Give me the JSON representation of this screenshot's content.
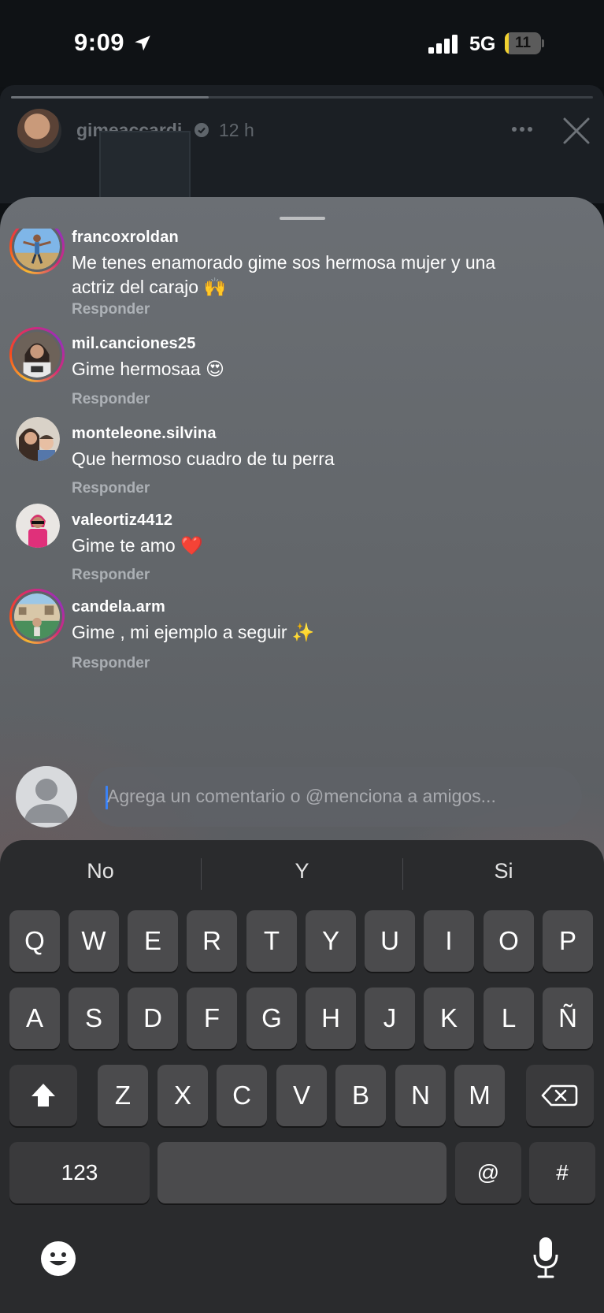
{
  "status_bar": {
    "time": "9:09",
    "network": "5G",
    "battery_level": "11",
    "battery_fraction": 0.11
  },
  "story": {
    "username": "gimeaccardi",
    "time_ago": "12 h",
    "progress": 0.34
  },
  "comments": [
    {
      "username": "francoxroldan",
      "text": "Me tenes enamorado gime sos hermosa mujer y una actriz del carajo 🙌",
      "reply": "Responder",
      "story_ring": true
    },
    {
      "username": "mil.canciones25",
      "text": "Gime hermosaa 😍",
      "reply": "Responder",
      "story_ring": true
    },
    {
      "username": "monteleone.silvina",
      "text": "Que hermoso cuadro de tu perra",
      "reply": "Responder",
      "story_ring": false
    },
    {
      "username": "valeortiz4412",
      "text": "Gime te amo ❤️",
      "reply": "Responder",
      "story_ring": false
    },
    {
      "username": "candela.arm",
      "text": "Gime , mi ejemplo a seguir ✨",
      "reply": "Responder",
      "story_ring": true
    }
  ],
  "quick_reactions": [
    "❤️",
    "🙌",
    "🔥",
    "👏",
    "😢",
    "😍",
    "😮",
    "😂"
  ],
  "composer": {
    "placeholder": "Agrega un comentario o @menciona a amigos..."
  },
  "keyboard": {
    "suggestions": [
      "No",
      "Y",
      "Si"
    ],
    "row1": [
      "Q",
      "W",
      "E",
      "R",
      "T",
      "Y",
      "U",
      "I",
      "O",
      "P"
    ],
    "row2": [
      "A",
      "S",
      "D",
      "F",
      "G",
      "H",
      "J",
      "K",
      "L",
      "Ñ"
    ],
    "row3": [
      "Z",
      "X",
      "C",
      "V",
      "B",
      "N",
      "M"
    ],
    "numbers_key": "123",
    "at_key": "@",
    "hash_key": "#"
  },
  "colors": {
    "story_ring_gradient": [
      "#f7b733",
      "#fc4a1a",
      "#d62976",
      "#962fbf"
    ],
    "caret": "#3b82f6",
    "key": "#4b4b4d",
    "keyboard_bg": "#2a2b2d"
  }
}
